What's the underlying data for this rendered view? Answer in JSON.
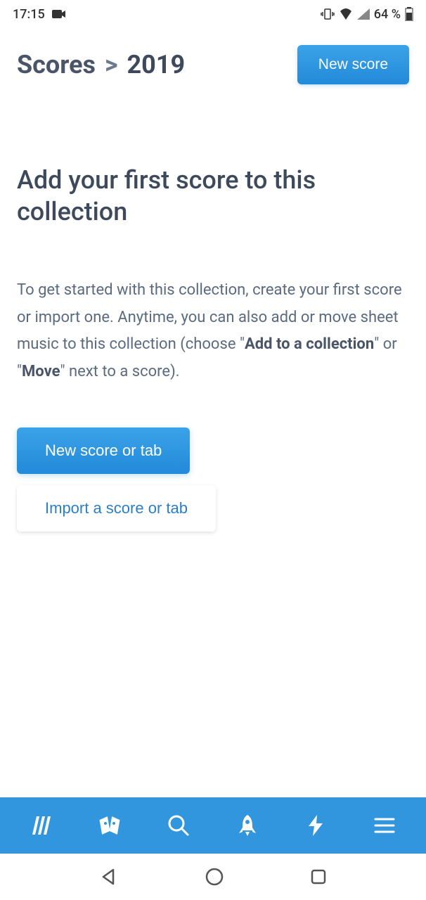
{
  "status_bar": {
    "time": "17:15",
    "battery_percent": "64 %"
  },
  "header": {
    "breadcrumb_root": "Scores",
    "breadcrumb_separator": ">",
    "breadcrumb_current": "2019",
    "new_score_button": "New score"
  },
  "content": {
    "title": "Add your first score to this collection",
    "description_part1": "To get started with this collection, create your first score or import one. Anytime, you can also add or move sheet music to this collection (choose \"",
    "description_bold1": "Add to a collection",
    "description_part2": "\" or \"",
    "description_bold2": "Move",
    "description_part3": "\" next to a score).",
    "new_score_tab_button": "New score or tab",
    "import_score_button": "Import a score or tab"
  }
}
